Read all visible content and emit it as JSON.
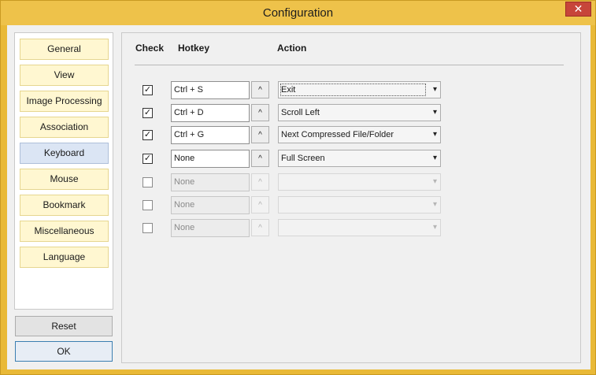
{
  "window": {
    "title": "Configuration",
    "close_label": "✕"
  },
  "nav": {
    "items": [
      {
        "label": "General",
        "active": false
      },
      {
        "label": "View",
        "active": false
      },
      {
        "label": "Image Processing",
        "active": false
      },
      {
        "label": "Association",
        "active": false
      },
      {
        "label": "Keyboard",
        "active": true
      },
      {
        "label": "Mouse",
        "active": false
      },
      {
        "label": "Bookmark",
        "active": false
      },
      {
        "label": "Miscellaneous",
        "active": false
      },
      {
        "label": "Language",
        "active": false
      }
    ]
  },
  "buttons": {
    "reset": "Reset",
    "ok": "OK"
  },
  "table": {
    "headers": {
      "check": "Check",
      "hotkey": "Hotkey",
      "action": "Action"
    },
    "up_arrow": "^",
    "dropdown_arrow": "▾",
    "check_mark": "✓",
    "rows": [
      {
        "checked": true,
        "hotkey": "Ctrl + S",
        "action": "Exit",
        "enabled": true,
        "focused": true
      },
      {
        "checked": true,
        "hotkey": "Ctrl + D",
        "action": "Scroll Left",
        "enabled": true,
        "focused": false
      },
      {
        "checked": true,
        "hotkey": "Ctrl + G",
        "action": "Next Compressed File/Folder",
        "enabled": true,
        "focused": false
      },
      {
        "checked": true,
        "hotkey": "None",
        "action": "Full Screen",
        "enabled": true,
        "focused": false
      },
      {
        "checked": false,
        "hotkey": "None",
        "action": "",
        "enabled": false,
        "focused": false
      },
      {
        "checked": false,
        "hotkey": "None",
        "action": "",
        "enabled": false,
        "focused": false
      },
      {
        "checked": false,
        "hotkey": "None",
        "action": "",
        "enabled": false,
        "focused": false
      }
    ]
  }
}
